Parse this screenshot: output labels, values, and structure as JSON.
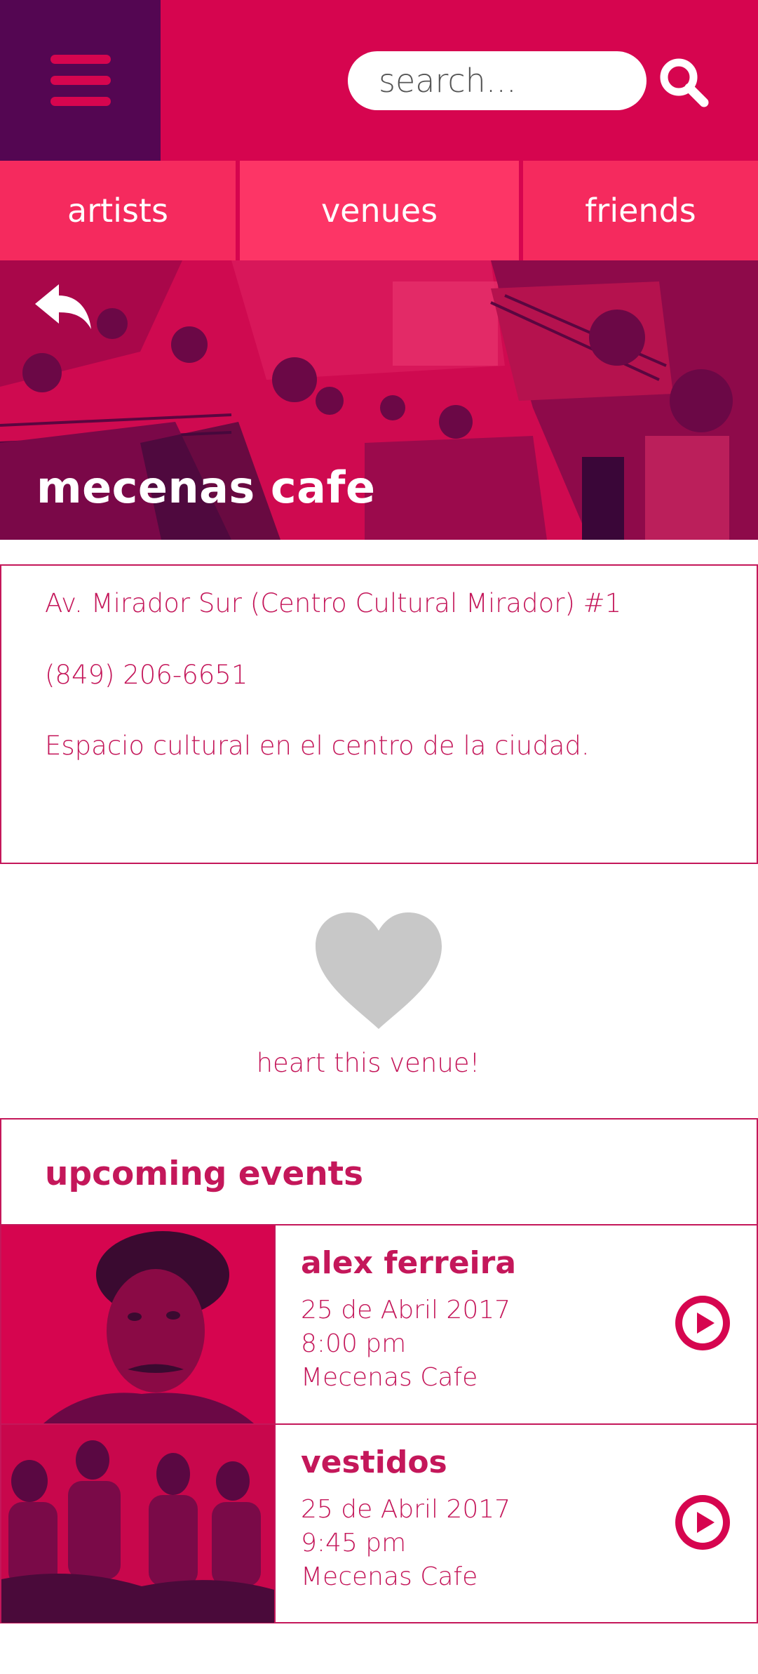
{
  "header": {
    "search_placeholder": "search...",
    "menu_icon": "hamburger-menu-icon",
    "search_icon": "magnifier-icon"
  },
  "tabs": [
    {
      "label": "artists"
    },
    {
      "label": "venues"
    },
    {
      "label": "friends"
    }
  ],
  "venue": {
    "name": "mecenas cafe",
    "address": "Av. Mirador Sur (Centro Cultural Mirador) #1",
    "phone": "(849) 206-6651",
    "description": "Espacio cultural en el centro de la ciudad.",
    "heart_label": "heart this venue!"
  },
  "events": {
    "title": "upcoming events",
    "items": [
      {
        "name": "alex ferreira",
        "date": "25 de Abril 2017",
        "time": "8:00 pm",
        "place": "Mecenas Cafe"
      },
      {
        "name": "vestidos",
        "date": "25 de Abril 2017",
        "time": "9:45 pm",
        "place": "Mecenas Cafe"
      }
    ]
  },
  "colors": {
    "brand_pink": "#d6054f",
    "menu_purple": "#540652",
    "tab_pink": "#f52a5e",
    "text_pink": "#c4175a",
    "heart_gray": "#c8c8c8"
  }
}
